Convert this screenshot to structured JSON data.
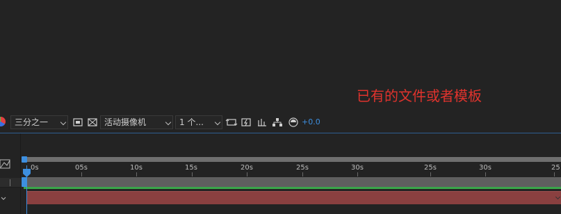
{
  "annotation": "已有的文件或者模板",
  "toolbar": {
    "resolution": "三分之一",
    "camera": "活动摄像机",
    "views": "1 个...",
    "exposure": "+0.0"
  },
  "colors": {
    "accent": "#3d8fe0",
    "annotation": "#e0332d",
    "track_green": "#3aa64a",
    "track_red": "#8a4040"
  },
  "icons": [
    "color-picker-icon",
    "region-of-interest-icon",
    "transparency-grid-icon",
    "fast-previews-icon",
    "timeline-flowchart-icon",
    "exposure-icon",
    "graph-editor-icon"
  ],
  "timeline": {
    "ticks": [
      "0s",
      "05s",
      "10s",
      "15s",
      "20s",
      "25s",
      "30s",
      "25s",
      "30s",
      "25"
    ]
  }
}
